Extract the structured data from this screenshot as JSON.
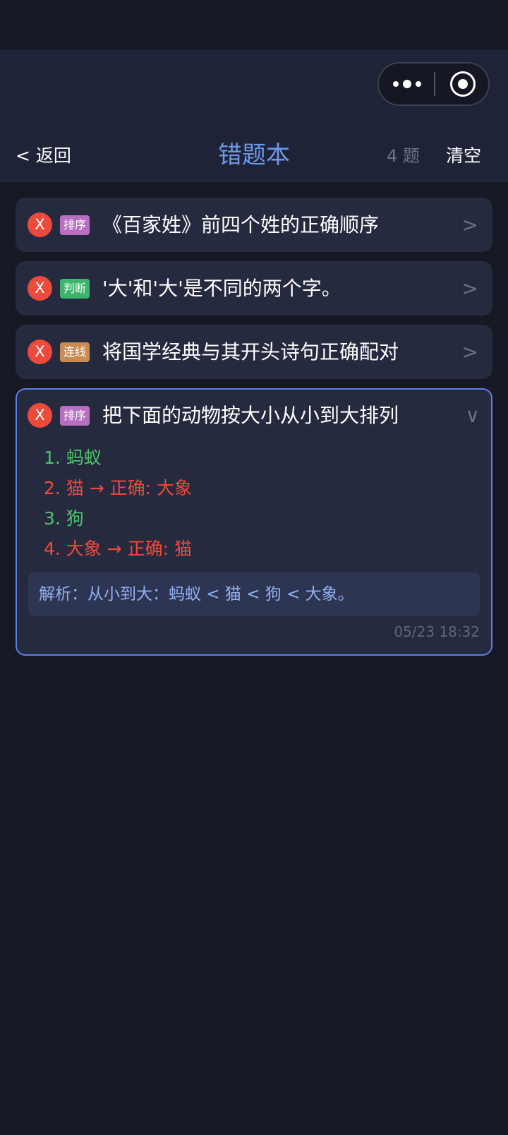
{
  "capsule": {
    "more_icon": "more-dots-icon",
    "close_icon": "target-circle-icon"
  },
  "nav": {
    "back_label": "< 返回",
    "title": "错题本",
    "count": "4 题",
    "clear_label": "清空"
  },
  "questions": [
    {
      "mark": "X",
      "tag": "排序",
      "tag_color": "#b96fc1",
      "title": "《百家姓》前四个姓的正确顺序",
      "chevron": ">"
    },
    {
      "mark": "X",
      "tag": "判断",
      "tag_color": "#3fb36a",
      "title": "'大'和'大'是不同的两个字。",
      "chevron": ">"
    },
    {
      "mark": "X",
      "tag": "连线",
      "tag_color": "#c78c54",
      "title": "将国学经典与其开头诗句正确配对",
      "chevron": ">"
    },
    {
      "mark": "X",
      "tag": "排序",
      "tag_color": "#b96fc1",
      "title": "把下面的动物按大小从小到大排列",
      "chevron": "∨",
      "answers": [
        {
          "text": "1. 蚂蚁",
          "status": "correct"
        },
        {
          "text": "2. 猫 → 正确: 大象",
          "status": "wrong"
        },
        {
          "text": "3. 狗",
          "status": "correct"
        },
        {
          "text": "4. 大象 → 正确: 猫",
          "status": "wrong"
        }
      ],
      "analysis": "解析：从小到大：蚂蚁 < 猫 < 狗 < 大象。",
      "time": "05/23 18:32"
    }
  ],
  "colors": {
    "background": "#161824",
    "header": "#1e2337",
    "card": "#262a3f",
    "accent": "#6d97e8",
    "correct": "#4ec46b",
    "wrong": "#f04a3a"
  }
}
